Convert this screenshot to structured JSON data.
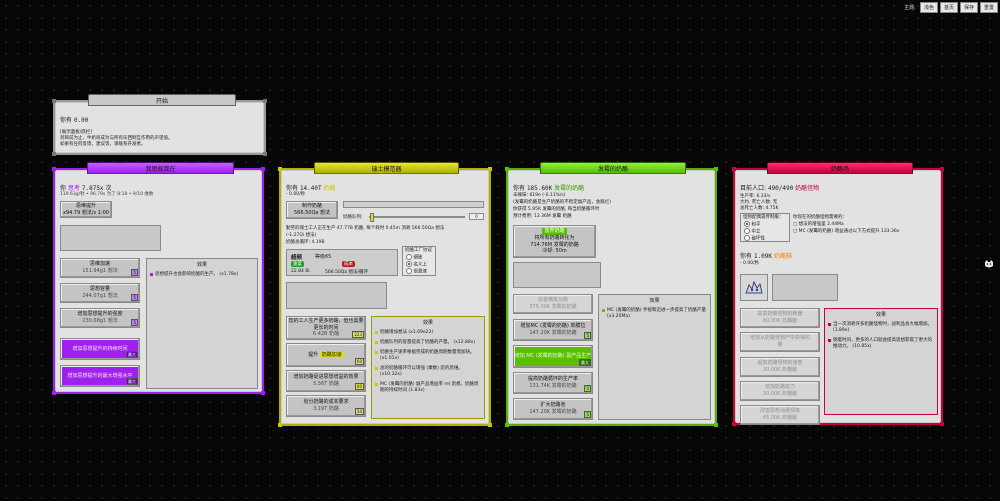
{
  "topbar": {
    "theme_label": "主题:",
    "buttons": [
      "浅色",
      "首页",
      "保存",
      "重置"
    ]
  },
  "colors": {
    "p1_title": "#a020f0",
    "p1_accent": "#a020f0",
    "p2_title": "#c8c800",
    "p2_accent": "#9a9a00",
    "p3_title": "#58c000",
    "p3_accent": "#3c9a00",
    "p4_title": "#c8003c",
    "p4_accent": "#c8003c"
  },
  "intro": {
    "title": "开始",
    "have_prefix": "你有",
    "amount": "0.00",
    "unit": "牛奶",
    "lines": [
      "[展示面板/底栏]",
      "到目前为止，牛奶商成为与所有乐西制互作用的声望值。",
      "如果有任何反馈、建议等，请联系开发者。"
    ]
  },
  "p1": {
    "title": "我思故我在",
    "have_prefix": "你",
    "have_mid": "思考",
    "amount": "7.875x",
    "amount_suffix": "次",
    "rate": "119.63g/秒 • 96.79s 为了 8:18 • 9/10 维数",
    "think_btn": {
      "line1": "思维提升",
      "line2": "x94.79 想法/s 1:00"
    },
    "buttons": [
      {
        "line1": "思维加速",
        "line2": "151.94g1 想法",
        "badge": "5"
      },
      {
        "line1": "思想容量",
        "line2": "244.07g1 想法",
        "badge": "5"
      },
      {
        "line1": "增加思想提升的强度",
        "line2": "230.68g1 想法",
        "badge": "5"
      },
      {
        "line1": "增加思想提升的持续时间",
        "line2": "",
        "badge": "最大"
      },
      {
        "line1": "增加思想提升的最大增强水平",
        "line2": "",
        "badge": "最大"
      }
    ],
    "effect": {
      "head": "效果",
      "item": "思想提升也会影响奶酪的生产。 (x1.78x)"
    }
  },
  "p2": {
    "title": "瑞士模范器",
    "have_prefix": "你有",
    "amount": "14.40T",
    "amount_unit": "奶酪",
    "rate": "- 0.00/秒",
    "make_btn": {
      "line1": "制作奶酪",
      "line2": "566.50Qa 想法"
    },
    "queue_label": "奶酪队列:",
    "queue_value": "0",
    "desc1": "勤劳的瑞士工人正在生产 47.77B 奶酪, 每个耗时 0.45m 消耗 566.50Qa 想法",
    "desc2": "(-1.27Qi 想法)",
    "desc3": "奶酪总循环: 4.19B",
    "super": {
      "label": "超频",
      "level": "等级65",
      "stat1": "22.84 Bi",
      "stat2": "566.50Qa 想法/循环",
      "tag1": "速度",
      "tag2": "成本"
    },
    "factory": {
      "title": "奶酪工厂协议",
      "options": [
        "细致",
        "名义上",
        "很激速"
      ],
      "selected": 1
    },
    "buttons": [
      {
        "line1": "您的工人生产更多奶酪，但也需要",
        "line2": "更长的时间",
        "line3": "6.42B 奶酪",
        "badge": "223"
      },
      {
        "line1": "提升",
        "line2": "奶酪加速",
        "line3": "",
        "badge": "60"
      },
      {
        "line1": "增加奶酪促进思想增益的效果",
        "line2": "5.56T 奶酪",
        "line3": "",
        "badge": "60"
      },
      {
        "line1": "划分奶酪的成本要求",
        "line2": "3.19T 奶酪",
        "line3": "",
        "badge": "34"
      }
    ],
    "effect": {
      "head": "效果",
      "items": [
        "奶酪增加想法 (x1.69e23)",
        "奶酪队列的容量提高了奶酪的产量。 (x12.88x)",
        "奶酪生产速率根据完成的奶酪周期数量而加快。 (x1.01x)",
        "总的奶酪循环可以增强 (乘数) 您的思维。 (x10.32x)",
        "MC (发霉的奶酪) 副产品增益率 rel 思想。奶酪周期的持续时间 (1.83x)"
      ]
    }
  },
  "p3": {
    "title": "发霉的奶酪",
    "have_prefix": "你有",
    "amount": "185.60K",
    "amount_unit": "发霉的奶酪",
    "lines": [
      "辛辣味: 619e (-0.11%/s)",
      "(发霉的奶酪是生产奶酪的不稳定副产品，会腐烂)",
      "你获得 5.95K 发霉的奶酪, 每当奶酪循环时",
      "预计费用: 13.36M 发霉 奶酪"
    ],
    "main_btn": {
      "line1": "放弃奶酪",
      "line2": "将所有奶酪转化为",
      "line3": "714.76M 发霉的奶酪",
      "line4": "冷却: 50m"
    },
    "buttons": [
      {
        "line1": "完善精炼功能",
        "line2": "375.00K 发霉的奶酪",
        "badge": "",
        "dis": true
      },
      {
        "line1": "增加MC (发霉的奶酪) 单膜拉",
        "line2": "147.20K 发霉的奶酪",
        "badge": "5"
      },
      {
        "line1": "增加 MC (发霉的奶酪) 副产品生产",
        "line2": "",
        "badge": "最大",
        "hl": true
      },
      {
        "line1": "提高奶酪循环的生产率",
        "line2": "131.74K 发霉的奶酪",
        "badge": "5"
      },
      {
        "line1": "扩大奶酪池",
        "line2": "147.20K 发霉的奶酪",
        "badge": "5"
      }
    ],
    "effect": {
      "head": "效果",
      "item": "MC (发霉的奶酪) 手视和迈进一步提高了奶酪产量 (x3.20Ma)"
    }
  },
  "p4": {
    "title": "奶酪场",
    "pop_label": "目前人口:",
    "pop_value": "490/490",
    "pop_unit": "奶酪怪物",
    "stats": [
      "生产率: 6.33/s",
      "大约. 死亡人数: 无",
      "总死亡人数: 4.75K"
    ],
    "monster_title": "怪物配偶遗传制服：",
    "radios": [
      "和平",
      "中立",
      "破坏性"
    ],
    "radio_selected": 0,
    "needs": [
      "你现在的奶酪怪物需要的：",
      "□ 想法的增强里 2.44Ma",
      "□ MC (发霉的奶酪) 增益通过以下方式提升 133.36x"
    ],
    "have_prefix": "你有",
    "have_amount": "1.09K",
    "have_unit": "奶酪脑",
    "rate": "- 0.00/秒",
    "buttons": [
      {
        "line1": "提高奶酪怪物的精器",
        "line2": "80.00K 奶酪脑"
      },
      {
        "line1": "增加从奶酪怪物产中获得的",
        "line2": "量"
      },
      {
        "line1": "提高奶酪怪物的速度",
        "line2": "30.00K 奶酪脑"
      },
      {
        "line1": "增加奶酪能力",
        "line2": "30.00K 奶酪脑"
      },
      {
        "line1": "改善思想消费规率",
        "line2": "45.00K 奶酪脑"
      }
    ],
    "effect": {
      "head": "效果",
      "items": [
        "当一次消耗许多奶酪怪物时，战利品会大幅增加。 (1.89x)",
        "随着时间，更多的人口就会提高思想获取了更大的推动力。 (10.85x)"
      ]
    }
  }
}
